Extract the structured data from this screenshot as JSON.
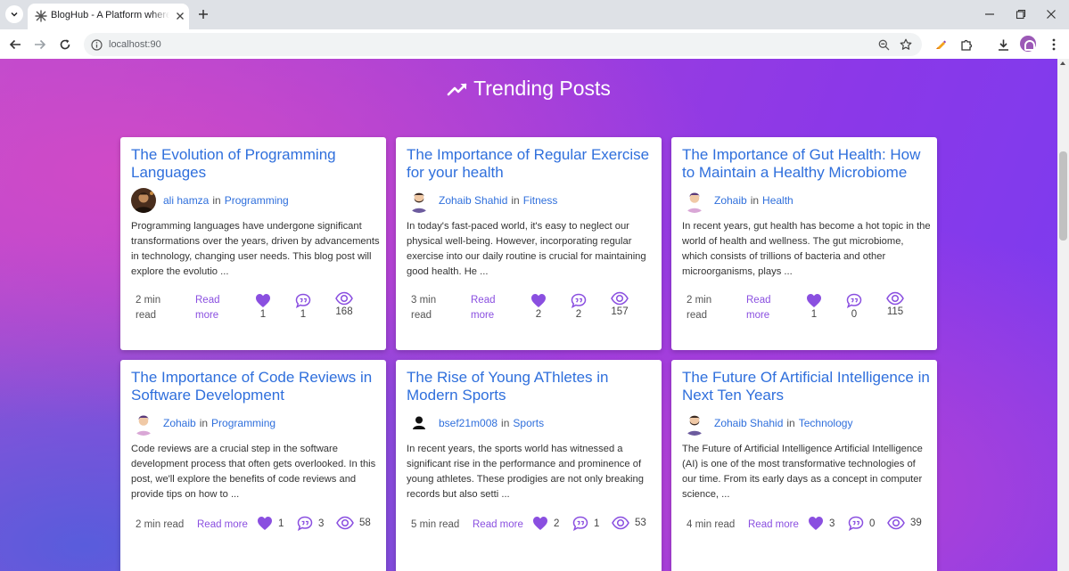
{
  "browser": {
    "tab_title": "BlogHub - A Platform where yo",
    "url": "localhost:90"
  },
  "page": {
    "section_title": "Trending Posts"
  },
  "posts": [
    {
      "title": "The Evolution of Programming Languages",
      "author": "ali hamza",
      "in_word": "in",
      "category": "Programming",
      "excerpt": "Programming languages have undergone significant transformations over the years, driven by advancements in technology, changing user needs. This blog post will explore the evolutio ...",
      "read_time": "2 min read",
      "read_more": "Read more",
      "likes": "1",
      "comments": "1",
      "views": "168",
      "avatar": "photo-avatar"
    },
    {
      "title": "The Importance of Regular Exercise for your health",
      "author": "Zohaib Shahid",
      "in_word": "in",
      "category": "Fitness",
      "excerpt": "In today's fast-paced world, it's easy to neglect our physical well-being. However, incorporating regular exercise into our daily routine is crucial for maintaining good health. He ...",
      "read_time": "3 min read",
      "read_more": "Read more",
      "likes": "2",
      "comments": "2",
      "views": "157",
      "avatar": "bearded-man-avatar"
    },
    {
      "title": "The Importance of Gut Health: How to Maintain a Healthy Microbiome",
      "author": "Zohaib",
      "in_word": "in",
      "category": "Health",
      "excerpt": "In recent years, gut health has become a hot topic in the world of health and wellness. The gut microbiome, which consists of trillions of bacteria and other microorganisms, plays ...",
      "read_time": "2 min read",
      "read_more": "Read more",
      "likes": "1",
      "comments": "0",
      "views": "115",
      "avatar": "man-avatar"
    },
    {
      "title": "The Importance of Code Reviews in Software Development",
      "author": "Zohaib",
      "in_word": "in",
      "category": "Programming",
      "excerpt": "Code reviews are a crucial step in the software development process that often gets overlooked. In this post, we'll explore the benefits of code reviews and provide tips on how to ...",
      "read_time": "2 min read",
      "read_more": "Read more",
      "likes": "1",
      "comments": "3",
      "views": "58",
      "avatar": "man-avatar"
    },
    {
      "title": "The Rise of Young AThletes in Modern Sports",
      "author": "bsef21m008",
      "in_word": "in",
      "category": "Sports",
      "excerpt": "In recent years, the sports world has witnessed a significant rise in the performance and prominence of young athletes. These prodigies are not only breaking records but also setti ...",
      "read_time": "5 min read",
      "read_more": "Read more",
      "likes": "2",
      "comments": "1",
      "views": "53",
      "avatar": "person-silhouette-icon"
    },
    {
      "title": "The Future Of Artificial Intelligence in Next Ten Years",
      "author": "Zohaib Shahid",
      "in_word": "in",
      "category": "Technology",
      "excerpt": "The Future of Artificial Intelligence Artificial Intelligence (AI) is one of the most transformative technologies of our time. From its early days as a concept in computer science, ...",
      "read_time": "4 min read",
      "read_more": "Read more",
      "likes": "3",
      "comments": "0",
      "views": "39",
      "avatar": "bearded-man-avatar"
    }
  ],
  "colors": {
    "accent_purple": "#8a4fe0",
    "link_blue": "#2f6fdc"
  }
}
